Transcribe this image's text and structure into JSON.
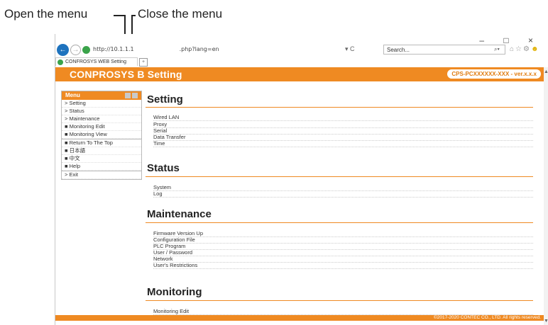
{
  "annotations": {
    "open_menu": "Open the menu",
    "close_menu": "Close the menu"
  },
  "browser": {
    "window_controls": "– □ ×",
    "back_glyph": "←",
    "forward_glyph": "→",
    "url_left": "http://10.1.1.1",
    "url_right": ".php?lang=en",
    "refresh_glyph": "▾ C",
    "search_placeholder": "Search...",
    "search_glyph": "⌕▾",
    "toolbar_icons": "⌂☆⚙",
    "smiley_glyph": "☻",
    "tab_label": "CONFROSYS WEB Setting",
    "new_tab_glyph": "+"
  },
  "header": {
    "title": "CONPROSYS  B Setting",
    "model": "CPS-PCXXXXXX-XXX - ver.x.x.x"
  },
  "menu": {
    "title": "Menu",
    "items": [
      {
        "label": "> Setting"
      },
      {
        "label": "> Status"
      },
      {
        "label": "> Maintenance"
      },
      {
        "label": "■ Monitoring Edit"
      },
      {
        "label": "■ Monitoring View"
      },
      {
        "label": "■ Return To The Top"
      },
      {
        "label": "■ 日本語"
      },
      {
        "label": "■ 中文"
      },
      {
        "label": "■ Help"
      },
      {
        "label": "> Exit"
      }
    ]
  },
  "sections": [
    {
      "title": "Setting",
      "items": [
        "Wired LAN",
        "Proxy",
        "Serial",
        "Data Transfer",
        "Time"
      ]
    },
    {
      "title": "Status",
      "items": [
        "System",
        "Log"
      ]
    },
    {
      "title": "Maintenance",
      "items": [
        "Firmware Version Up",
        "Configuration File",
        "PLC Program",
        "User / Password",
        "Network",
        "User's Restrictions"
      ]
    },
    {
      "title": "Monitoring",
      "items": [
        "Monitoring Edit"
      ]
    }
  ],
  "footer": {
    "copyright": "©2017-2020 CONTEC CO., LTD. All rights reserved."
  },
  "scroll": {
    "up": "▲",
    "down": "▼"
  }
}
